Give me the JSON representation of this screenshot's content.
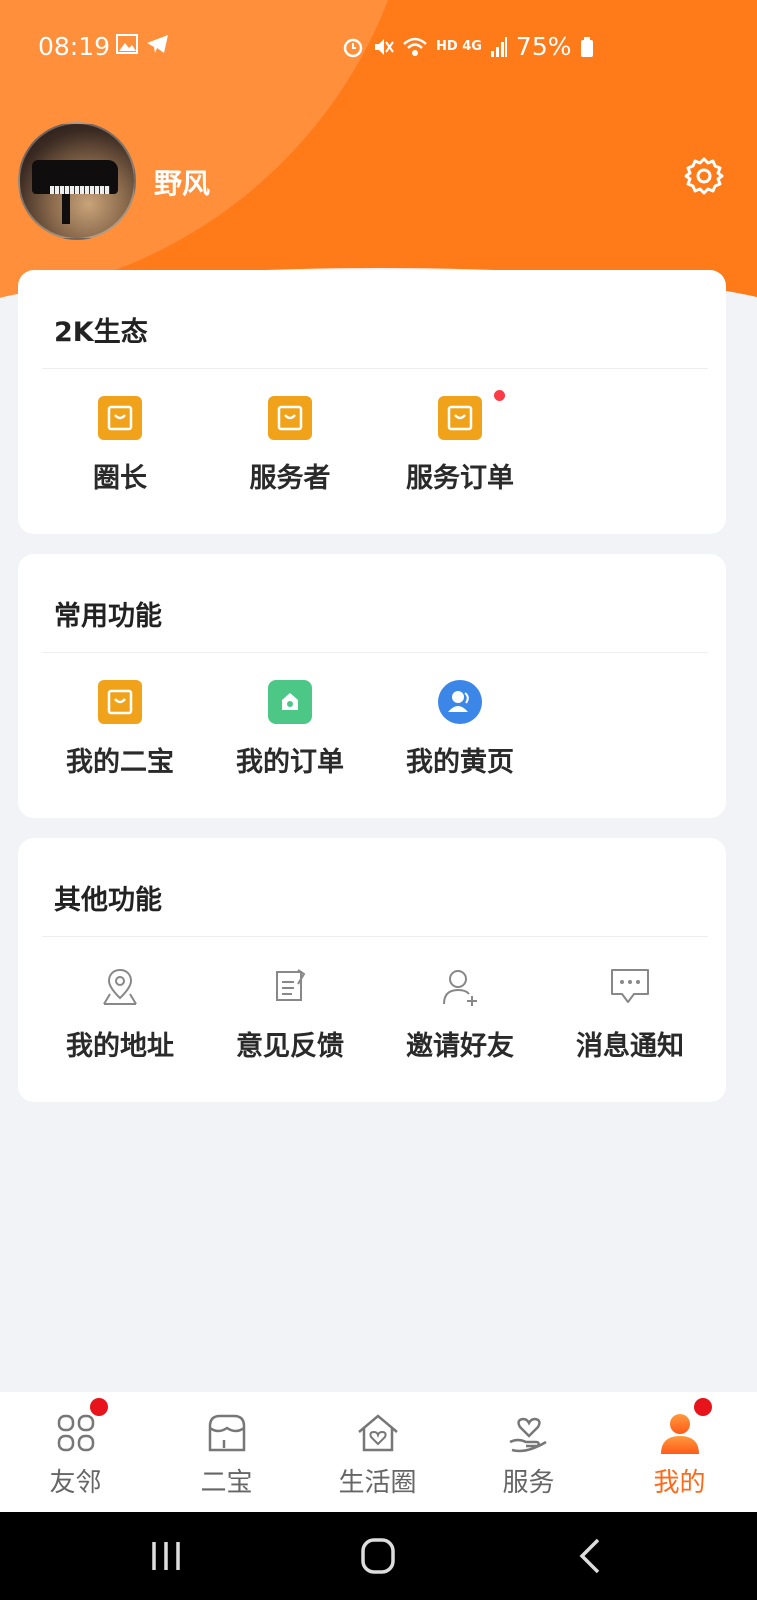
{
  "status_bar": {
    "time": "08:19",
    "battery": "75%",
    "network": "HD 4G"
  },
  "profile": {
    "name": "野风"
  },
  "sections": {
    "eco": {
      "title": "2K生态",
      "items": [
        {
          "label": "圈长",
          "icon": "bag-icon"
        },
        {
          "label": "服务者",
          "icon": "bag-icon"
        },
        {
          "label": "服务订单",
          "icon": "bag-icon",
          "has_badge": true
        }
      ]
    },
    "common": {
      "title": "常用功能",
      "items": [
        {
          "label": "我的二宝",
          "icon": "bag-icon"
        },
        {
          "label": "我的订单",
          "icon": "home-order-icon"
        },
        {
          "label": "我的黄页",
          "icon": "contacts-icon"
        }
      ]
    },
    "other": {
      "title": "其他功能",
      "items": [
        {
          "label": "我的地址",
          "icon": "location-icon"
        },
        {
          "label": "意见反馈",
          "icon": "feedback-icon"
        },
        {
          "label": "邀请好友",
          "icon": "add-user-icon"
        },
        {
          "label": "消息通知",
          "icon": "message-icon"
        }
      ]
    }
  },
  "tabbar": {
    "tabs": [
      {
        "label": "友邻",
        "icon": "grid-icon",
        "has_dot": true
      },
      {
        "label": "二宝",
        "icon": "shop-icon"
      },
      {
        "label": "生活圈",
        "icon": "house-heart-icon"
      },
      {
        "label": "服务",
        "icon": "hand-heart-icon"
      },
      {
        "label": "我的",
        "icon": "person-icon",
        "active": true,
        "has_dot": true
      }
    ],
    "active_color": "#ff6a1a"
  },
  "colors": {
    "header": "#ff7a18",
    "badge": "#ff3b45"
  }
}
